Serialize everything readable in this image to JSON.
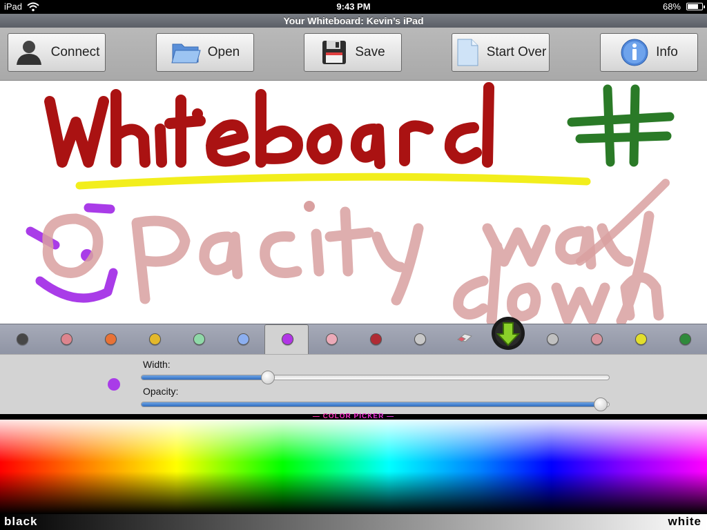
{
  "status": {
    "carrier": "iPad",
    "time": "9:43 PM",
    "battery": "68%"
  },
  "window": {
    "title": "Your Whiteboard: Kevin’s iPad"
  },
  "toolbar": {
    "buttons": [
      {
        "label": "Connect",
        "icon": "person-icon"
      },
      {
        "label": "Open",
        "icon": "folder-icon"
      },
      {
        "label": "Save",
        "icon": "floppy-disk-icon"
      },
      {
        "label": "Start Over",
        "icon": "blank-page-icon"
      },
      {
        "label": "Info",
        "icon": "info-icon"
      }
    ]
  },
  "palette": {
    "colors": [
      "#474747",
      "#dd858e",
      "#e87236",
      "#e3b82a",
      "#8fd9a8",
      "#8caff0",
      "#b135e6",
      "#ecaab8",
      "#b02b34",
      "#c8c8c8",
      "#c0c0c0",
      "#d7939c",
      "#e2de2c",
      "#2f8a3b"
    ],
    "selected_color": "#b135e6"
  },
  "settings": {
    "width_label": "Width:",
    "opacity_label": "Opacity:",
    "width_value": 0.27,
    "opacity_value": 0.98,
    "current_color": "#a93ce8"
  },
  "color_picker": {
    "title": "— COLOR PICKER —",
    "black_label": "black",
    "white_label": "white"
  },
  "drawing": {
    "texts": [
      "Whiteboard",
      "#",
      "Opacity",
      "way",
      "down"
    ],
    "colors": {
      "red": "#aa1212",
      "green": "#2a7a27",
      "yellow": "#f2ee1c",
      "purple": "#a93ce8",
      "pink": "#d9a0a0"
    }
  }
}
